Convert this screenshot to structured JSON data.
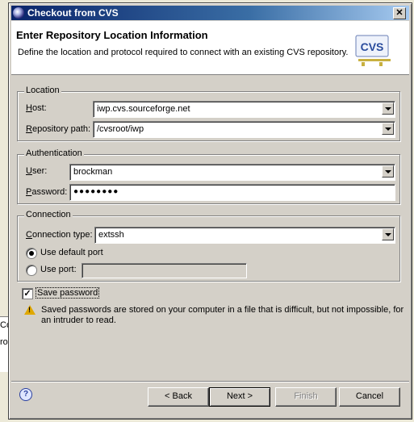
{
  "window": {
    "title": "Checkout from CVS",
    "close_label": "✕"
  },
  "banner": {
    "title": "Enter Repository Location Information",
    "description": "Define the location and protocol required to connect with an existing CVS repository.",
    "icon_text": "CVS"
  },
  "location": {
    "group_label": "Location",
    "host_label": "Host:",
    "host_value": "iwp.cvs.sourceforge.net",
    "repo_label": "Repository path:",
    "repo_value": "/cvsroot/iwp"
  },
  "authentication": {
    "group_label": "Authentication",
    "user_label": "User:",
    "user_value": "brockman",
    "password_label": "Password:",
    "password_value": "●●●●●●●●"
  },
  "connection": {
    "group_label": "Connection",
    "type_label": "Connection type:",
    "type_value": "extssh",
    "default_port_label": "Use default port",
    "use_port_label": "Use port:",
    "port_value": ""
  },
  "save_password": {
    "label": "Save password",
    "checked": true,
    "warning_line1": "Saved passwords are stored on your computer in a file that is difficult, but not impossible, for",
    "warning_line2": "an intruder to read."
  },
  "buttons": {
    "back": "< Back",
    "next": "Next >",
    "finish": "Finish",
    "cancel": "Cancel"
  },
  "background": {
    "frag1": "Co",
    "frag2": "ro"
  }
}
